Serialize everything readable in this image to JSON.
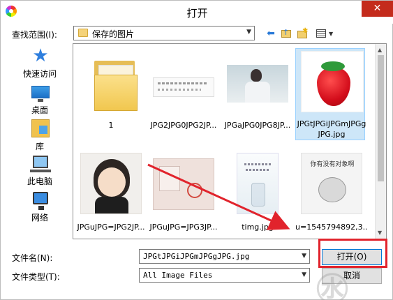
{
  "window": {
    "title": "打开",
    "close_label": "✕"
  },
  "toolbar": {
    "look_in_label": "查找范围(I):",
    "look_in_value": "保存的图片",
    "back_icon": "back-arrow-icon",
    "up_icon": "up-folder-icon",
    "new_folder_icon": "new-folder-icon",
    "view_icon": "view-menu-icon"
  },
  "places": [
    {
      "label": "快速访问",
      "icon": "quick-access-star-icon"
    },
    {
      "label": "桌面",
      "icon": "desktop-icon"
    },
    {
      "label": "库",
      "icon": "library-icon"
    },
    {
      "label": "此电脑",
      "icon": "this-pc-icon"
    },
    {
      "label": "网络",
      "icon": "network-icon"
    }
  ],
  "files": [
    {
      "name": "1",
      "type": "folder"
    },
    {
      "name": "JPG2JPG0JPG2JP...",
      "type": "image"
    },
    {
      "name": "JPGaJPG0JPG8JP...",
      "type": "image"
    },
    {
      "name": "JPGtJPGiJPGmJPGg",
      "name2": "JPG.jpg",
      "type": "image",
      "selected": true
    },
    {
      "name": "JPGuJPG=JPG2JP...",
      "type": "image"
    },
    {
      "name": "JPGuJPG=JPG3JP...",
      "type": "image"
    },
    {
      "name": "timg.jpg",
      "type": "image"
    },
    {
      "name": "u=1545794892,3...",
      "type": "image",
      "caption": "你有没有对象啊"
    }
  ],
  "form": {
    "filename_label": "文件名(N):",
    "filename_value": "JPGtJPGiJPGmJPGgJPG.jpg",
    "filetype_label": "文件类型(T):",
    "filetype_value": "All Image Files",
    "open_label": "打开(O)",
    "cancel_label": "取消"
  },
  "annotation": {
    "highlight_color": "#e1232c"
  }
}
